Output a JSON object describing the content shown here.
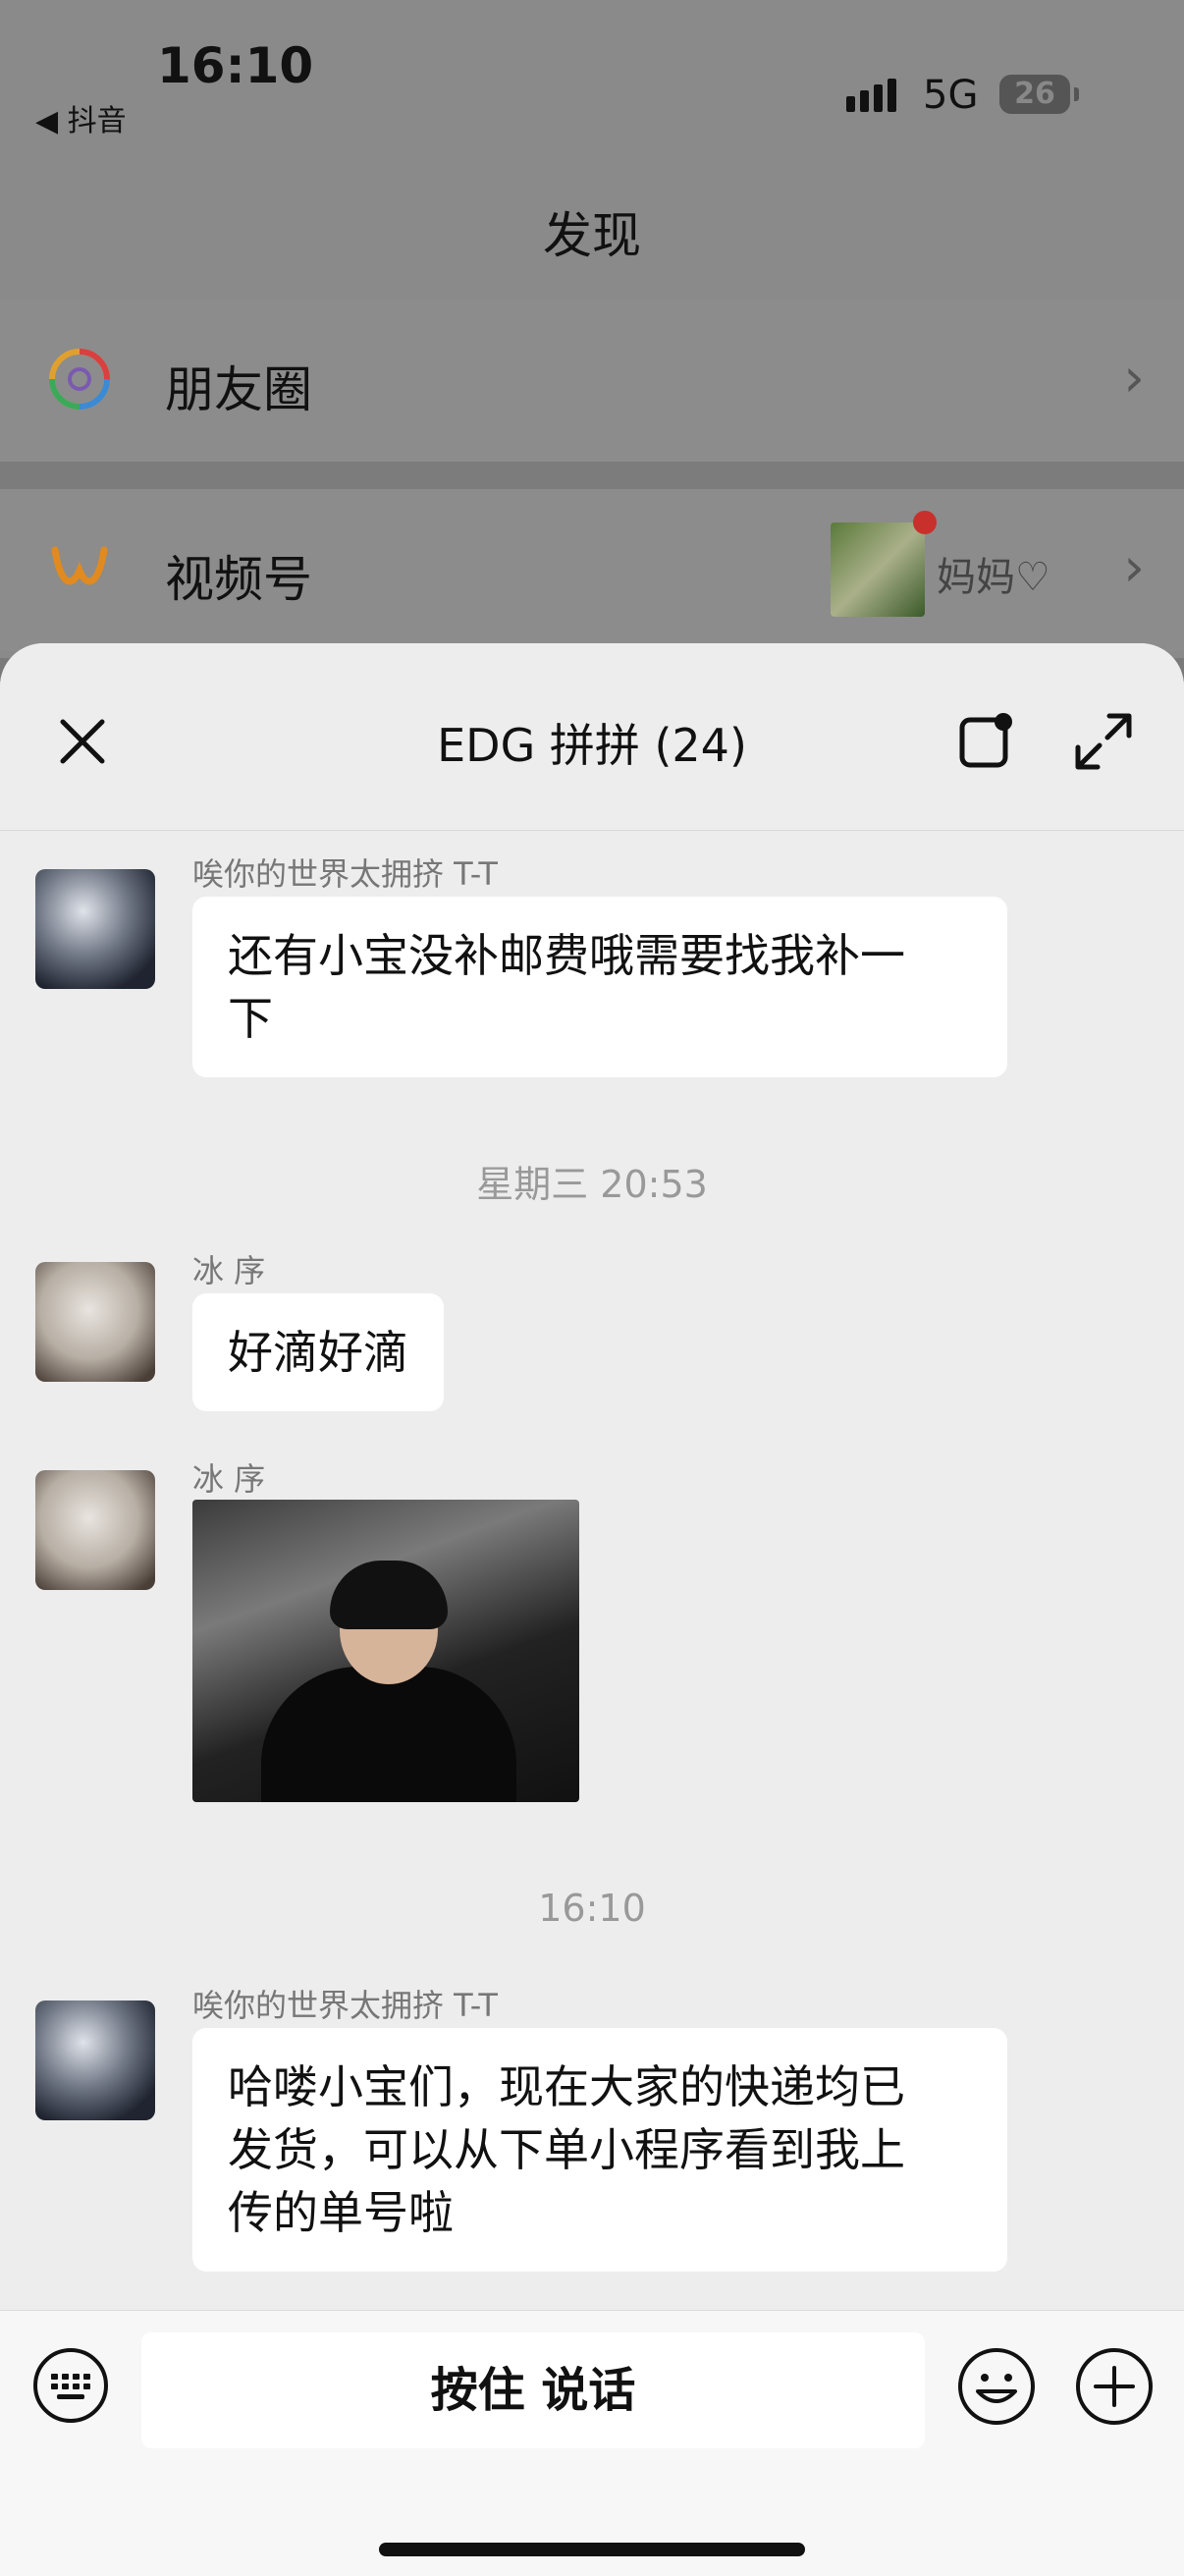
{
  "status": {
    "time": "16:10",
    "back_app": "◀ 抖音",
    "network": "5G",
    "battery": "26"
  },
  "discover": {
    "title": "发现",
    "items": [
      {
        "label": "朋友圈",
        "icon": "moments-aperture-icon"
      },
      {
        "label": "视频号",
        "icon": "channels-icon",
        "badge_name": "妈妈"
      }
    ]
  },
  "chat": {
    "title": "EDG 拼拼 (24)",
    "messages": [
      {
        "sender": "唉你的世界太拥挤 T-T",
        "text_lines": [
          "还有小宝没补邮费哦需要找我补一",
          "下"
        ]
      },
      {
        "timestamp": "星期三 20:53"
      },
      {
        "sender": "冰 序",
        "text_lines": [
          "好滴好滴"
        ]
      },
      {
        "sender": "冰 序",
        "type": "image"
      },
      {
        "timestamp": "16:10"
      },
      {
        "sender": "唉你的世界太拥挤 T-T",
        "text_lines": [
          "哈喽小宝们，现在大家的快递均已",
          "发货，可以从下单小程序看到我上",
          "传的单号啦"
        ]
      }
    ]
  },
  "input_bar": {
    "talk_label": "按住 说话"
  },
  "colors": {
    "sheet_bg": "#ededed",
    "bubble_bg": "#ffffff",
    "accent_red": "#c8302c"
  }
}
